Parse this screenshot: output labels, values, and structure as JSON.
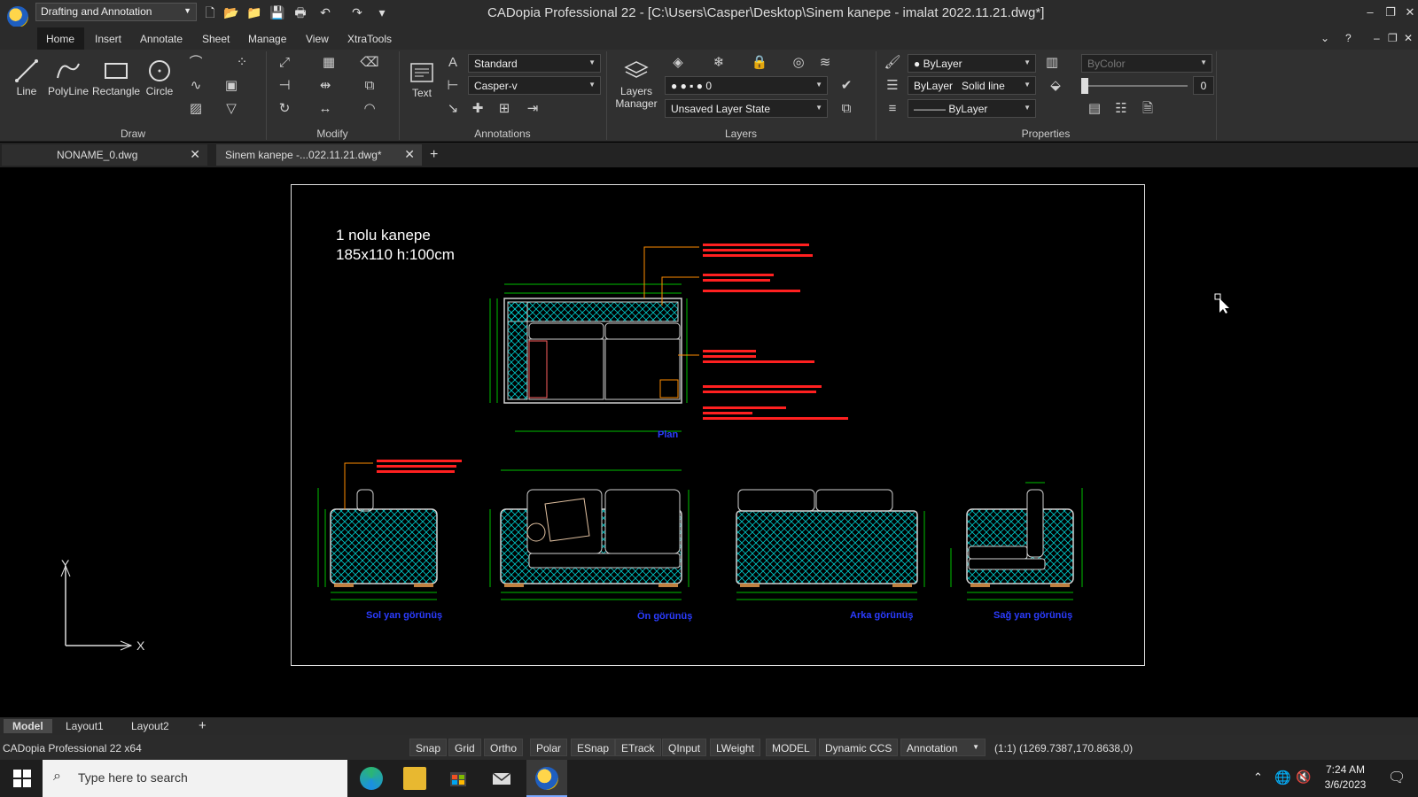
{
  "app": {
    "title": "CADopia Professional 22 - [C:\\Users\\Casper\\Desktop\\Sinem kanepe - imalat 2022.11.21.dwg*]",
    "workspace": "Drafting and Annotation"
  },
  "menu": {
    "items": [
      "Home",
      "Insert",
      "Annotate",
      "Sheet",
      "Manage",
      "View",
      "XtraTools"
    ]
  },
  "ribbon": {
    "draw": {
      "label": "Draw",
      "line": "Line",
      "polyline": "PolyLine",
      "rectangle": "Rectangle",
      "circle": "Circle"
    },
    "modify": {
      "label": "Modify"
    },
    "annotations": {
      "label": "Annotations",
      "text": "Text",
      "text_style": "Standard",
      "dim_style": "Casper-v"
    },
    "layers": {
      "label": "Layers",
      "manager": "Layers Manager",
      "current_layer": "0",
      "layer_state": "Unsaved Layer State"
    },
    "properties": {
      "label": "Properties",
      "color": "ByLayer",
      "linetype_layer": "ByLayer",
      "linetype": "Solid line",
      "lineweight": "ByLayer",
      "plot_style": "ByColor",
      "transparency": "0"
    }
  },
  "doc_tabs": [
    "NONAME_0.dwg",
    "Sinem kanepe -...022.11.21.dwg*"
  ],
  "drawing": {
    "title_line1": "1 nolu kanepe",
    "title_line2": "185x110 h:100cm",
    "views": [
      "Plan",
      "Sol yan görünüş",
      "Ön görünüş",
      "Arka görünüş",
      "Sağ yan görünüş"
    ],
    "axis_x": "X",
    "axis_y": "Y"
  },
  "layouts": [
    "Model",
    "Layout1",
    "Layout2"
  ],
  "status": {
    "product": "CADopia Professional 22 x64",
    "buttons": [
      "Snap",
      "Grid",
      "Ortho",
      "Polar",
      "ESnap",
      "ETrack",
      "QInput",
      "LWeight",
      "MODEL",
      "Dynamic CCS"
    ],
    "annotation_scale": "Annotation",
    "scale_ratio": "(1:1)",
    "coordinates": "(1269.7387,170.8638,0)"
  },
  "taskbar": {
    "search_placeholder": "Type here to search",
    "time": "7:24 AM",
    "date": "3/6/2023"
  },
  "colors": {
    "accent_cyan": "#00c8c8",
    "dim_green": "#00c000",
    "note_red": "#ff2020",
    "label_blue": "#2b3cff"
  }
}
